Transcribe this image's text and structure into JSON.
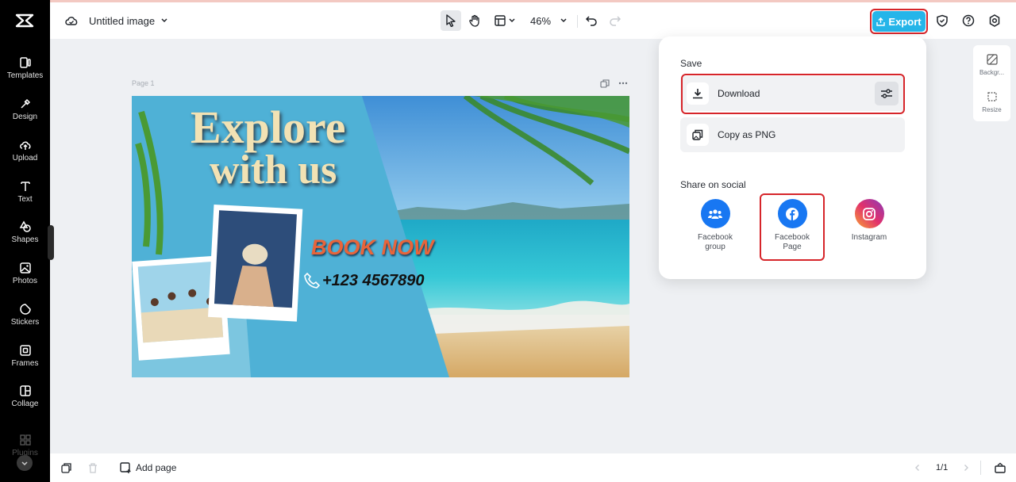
{
  "app": {
    "doc_title": "Untitled image",
    "zoom": "46%",
    "export_label": "Export"
  },
  "sidebar": {
    "items": [
      {
        "label": "Templates",
        "icon": "templates-icon"
      },
      {
        "label": "Design",
        "icon": "design-icon"
      },
      {
        "label": "Upload",
        "icon": "upload-icon"
      },
      {
        "label": "Text",
        "icon": "text-icon"
      },
      {
        "label": "Shapes",
        "icon": "shapes-icon"
      },
      {
        "label": "Photos",
        "icon": "photos-icon"
      },
      {
        "label": "Stickers",
        "icon": "stickers-icon"
      },
      {
        "label": "Frames",
        "icon": "frames-icon"
      },
      {
        "label": "Collage",
        "icon": "collage-icon"
      },
      {
        "label": "Plugins",
        "icon": "plugins-icon"
      }
    ]
  },
  "canvas": {
    "page_label": "Page 1",
    "design": {
      "headline_line1": "Explore",
      "headline_line2": "with us",
      "cta": "BOOK NOW",
      "phone": "+123 4567890"
    }
  },
  "right_panel": {
    "background_label": "Backgr...",
    "resize_label": "Resize"
  },
  "export_popup": {
    "save_title": "Save",
    "download_label": "Download",
    "copy_label": "Copy as PNG",
    "share_title": "Share on social",
    "social": [
      {
        "label_line1": "Facebook",
        "label_line2": "group",
        "color": "#1877f2"
      },
      {
        "label_line1": "Facebook",
        "label_line2": "Page",
        "color": "#1877f2"
      },
      {
        "label_line1": "Instagram",
        "label_line2": "",
        "color": "#e1306c"
      }
    ]
  },
  "bottom": {
    "add_page": "Add page",
    "pager": "1/1"
  },
  "colors": {
    "accent": "#25b5e9",
    "highlight": "#d6252a",
    "sidebar_bg": "#000000"
  }
}
